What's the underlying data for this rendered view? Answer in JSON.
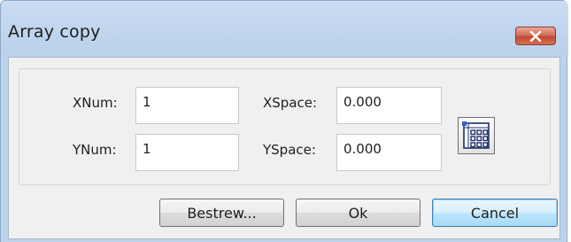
{
  "window": {
    "title": "Array copy",
    "close_icon": "close-icon"
  },
  "fields": {
    "xnum_label": "XNum:",
    "xnum_value": "1",
    "ynum_label": "YNum:",
    "ynum_value": "1",
    "xspace_label": "XSpace:",
    "xspace_value": "0.000",
    "yspace_label": "YSpace:",
    "yspace_value": "0.000"
  },
  "grid_button_icon": "array-grid-icon",
  "buttons": {
    "bestrew": "Bestrew...",
    "ok": "Ok",
    "cancel": "Cancel"
  },
  "colors": {
    "titlebar": "#bcd3ec",
    "close": "#c34a32",
    "default_button_border": "#3c7fb1"
  }
}
